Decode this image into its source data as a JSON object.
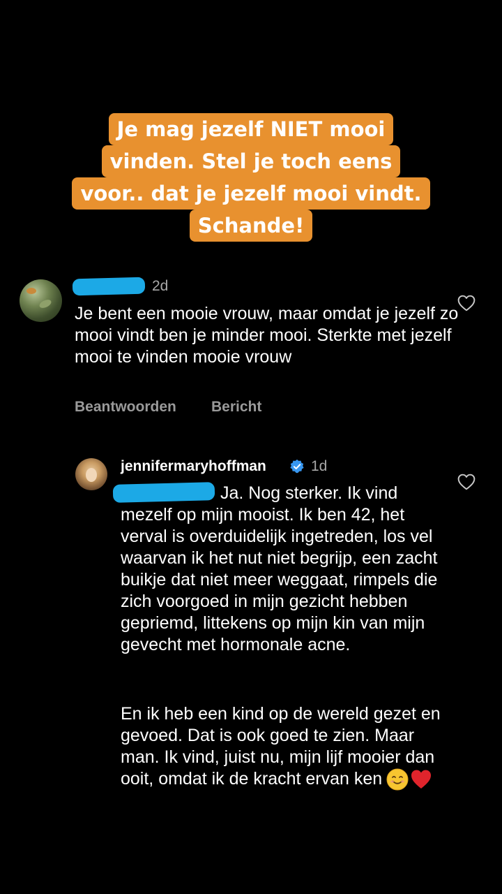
{
  "story": {
    "caption_lines": [
      "Je mag jezelf NIET mooi",
      "vinden. Stel je toch eens",
      "voor.. dat je jezelf mooi vindt.",
      "Schande!"
    ],
    "accent_color": "#e8912f"
  },
  "comment": {
    "time": "2d",
    "text": "Je bent een mooie vrouw, maar omdat je jezelf zo mooi vindt ben je minder mooi. Sterkte met jezelf mooi te vinden mooie vrouw",
    "reply_label": "Beantwoorden",
    "message_label": "Bericht",
    "like_icon": "heart-outline-icon"
  },
  "reply": {
    "username": "jennifermaryhoffman",
    "verified_icon": "verified-badge-icon",
    "time": "1d",
    "first_line": "Ja. Nog sterker. Ik vind",
    "paragraph_1": "mezelf op mijn mooist. Ik ben 42, het verval is overduidelijk ingetreden, los vel waarvan ik het nut niet begrijp, een zacht buikje dat niet meer weggaat, rimpels die zich voorgoed in mijn gezicht hebben gepriemd, littekens op mijn kin van mijn gevecht met hormonale acne.",
    "paragraph_2": "En ik heb een kind op de wereld gezet en gevoed. Dat is ook goed te zien. Maar man. Ik vind, juist nu, mijn lijf mooier dan ooit, omdat ik de kracht ervan ken",
    "emojis": [
      "smiling-face-emoji",
      "red-heart-emoji"
    ],
    "like_icon": "heart-outline-icon"
  },
  "colors": {
    "background": "#000000",
    "redaction": "#1ca9e6",
    "muted_text": "#a8a8a8",
    "verified": "#3897f0"
  }
}
